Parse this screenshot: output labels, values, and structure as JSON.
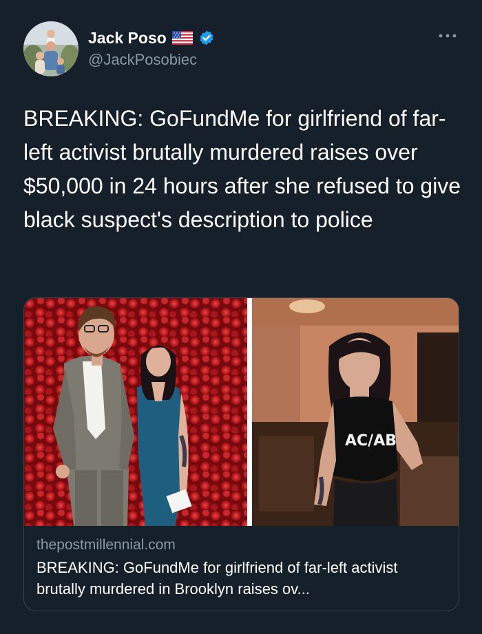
{
  "author": {
    "display_name": "Jack Poso",
    "handle": "@JackPosobiec",
    "flag_icon": "us-flag-icon",
    "verified_icon": "verified-badge-icon"
  },
  "tweet": {
    "text": "BREAKING: GoFundMe for girlfriend of far-left activist brutally murdered raises over $50,000 in 24 hours after she refused to give black suspect's description to police"
  },
  "link_card": {
    "domain": "thepostmillennial.com",
    "title": "BREAKING: GoFundMe for girlfriend of far-left activist brutally murdered in Brooklyn raises ov...",
    "images": [
      {
        "name": "couple-photo",
        "description_icon": "photo"
      },
      {
        "name": "woman-photo",
        "shirt_text": "AC/AB"
      }
    ]
  },
  "colors": {
    "background": "#15202b",
    "text_primary": "#ffffff",
    "text_secondary": "#8b98a5",
    "verified_blue": "#1d9bf0",
    "border": "#38444d"
  }
}
